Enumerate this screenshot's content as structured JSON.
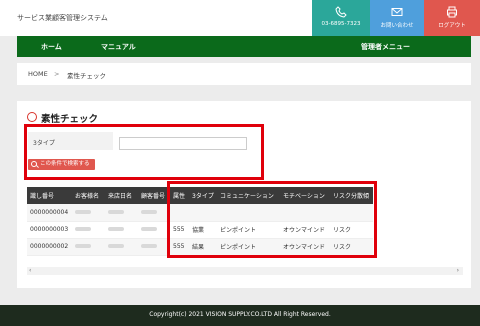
{
  "header": {
    "app_title": "サービス業顧客管理システム",
    "phone_number": "03-6895-7323",
    "contact_label": "お問い合わせ",
    "logout_label": "ログアウト"
  },
  "nav": {
    "home": "ホーム",
    "manual": "マニュアル",
    "admin_menu": "管理者メニュー"
  },
  "breadcrumb": {
    "home": "HOME",
    "separator": ">",
    "current": "素性チェック"
  },
  "page": {
    "title": "素性チェック"
  },
  "filter": {
    "label": "3タイプ",
    "input_value": "",
    "search_button": "この条件で検索する"
  },
  "table": {
    "columns": [
      "識し番号",
      "お客様名",
      "来店日名",
      "顧客番号",
      "属性",
      "3タイプ",
      "コミュニケーション",
      "モチベーション",
      "リスク分散傾"
    ],
    "rows": [
      {
        "id": "0000000004",
        "attr": "",
        "type3": "",
        "communication": "",
        "motivation": "",
        "risk": ""
      },
      {
        "id": "0000000003",
        "attr": "555",
        "type3": "協業",
        "communication": "ピンポイント",
        "motivation": "オウンマインド",
        "risk": "リスク"
      },
      {
        "id": "0000000002",
        "attr": "555",
        "type3": "結果",
        "communication": "ピンポイント",
        "motivation": "オウンマインド",
        "risk": "リスク"
      }
    ]
  },
  "scrollbar": {
    "left_arrow": "‹",
    "right_arrow": "›"
  },
  "footer": {
    "copyright": "Copyright(c) 2021 VISION SUPPLY.CO.LTD All Right Reserved."
  },
  "colors": {
    "nav_green": "#0b6a1b",
    "phone_teal": "#2ba79a",
    "mail_blue": "#4f9fdc",
    "logout_red": "#e0574e",
    "highlight_red": "#e0000b"
  }
}
